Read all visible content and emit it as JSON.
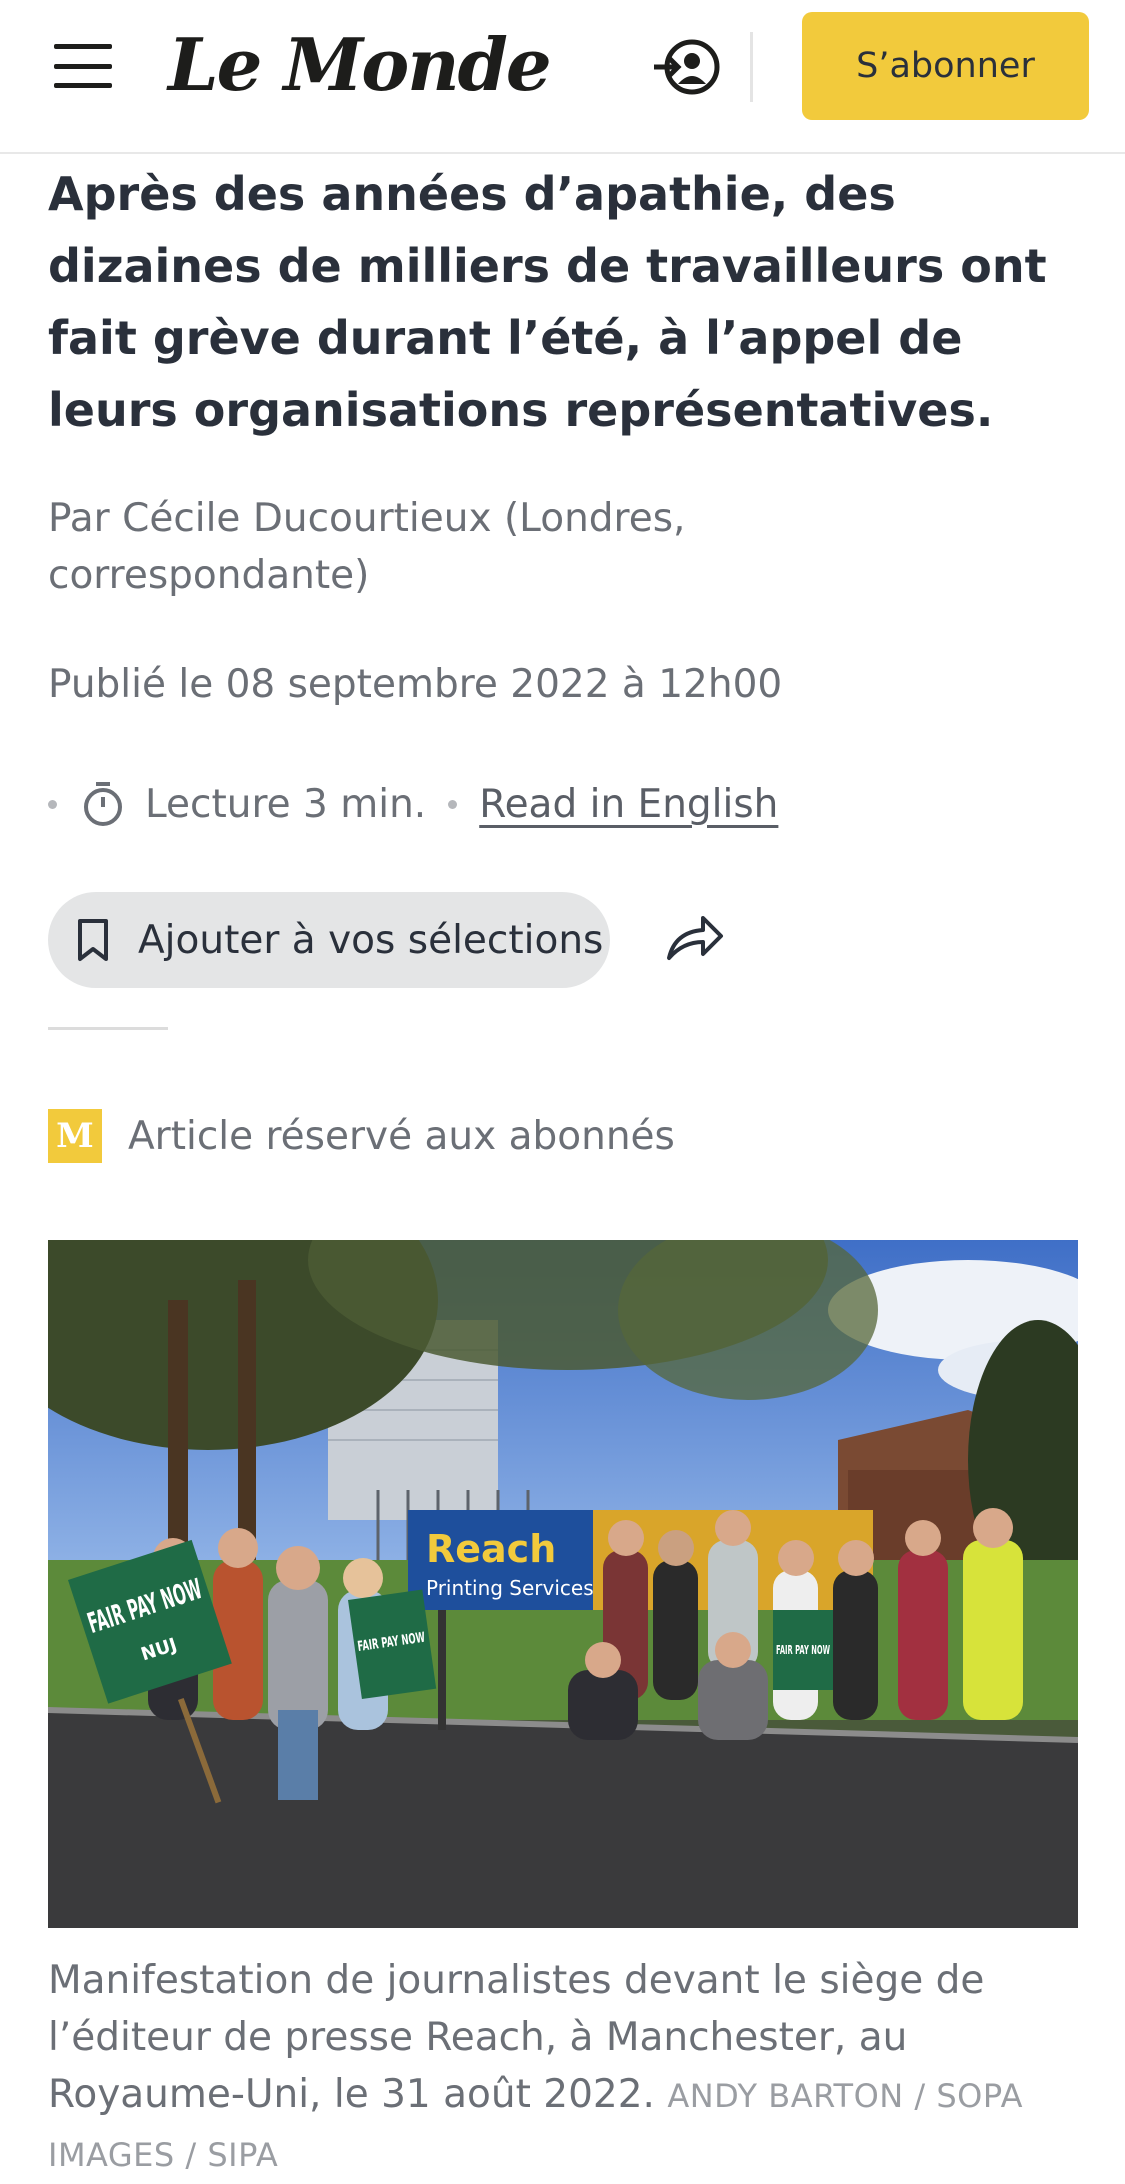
{
  "header": {
    "logo": "Le Monde",
    "subscribe_label": "S’abonner"
  },
  "article": {
    "summary": "Après des années d’apathie, des dizaines de milliers de travailleurs ont fait grève durant l’été, à l’appel de leurs organisations représentatives.",
    "byline": "Par Cécile Ducourtieux (Londres, correspondante)",
    "published": "Publié le 08 septembre 2022 à 12h00",
    "reading_time": "Lecture 3 min.",
    "read_in_english": "Read in English",
    "bookmark_label": "Ajouter à vos sélections",
    "premium_badge": "M",
    "premium_label": "Article réservé aux abonnés",
    "photo_signs": {
      "fair_pay_now": "FAIR PAY NOW",
      "nuj": "NUJ",
      "reach": "Reach",
      "printing_services": "Printing Services"
    },
    "caption": "Manifestation de journalistes devant le siège de l’éditeur de presse Reach, à Manchester, au Royaume-Uni, le 31 août 2022.",
    "credit": "ANDY BARTON / SOPA IMAGES / SIPA"
  },
  "colors": {
    "accent_yellow": "#f2ca3c",
    "text_dark": "#2a303b",
    "text_muted": "#6b6f76"
  },
  "icons": [
    "menu-icon",
    "user-login-icon",
    "timer-icon",
    "bookmark-icon",
    "share-icon"
  ]
}
